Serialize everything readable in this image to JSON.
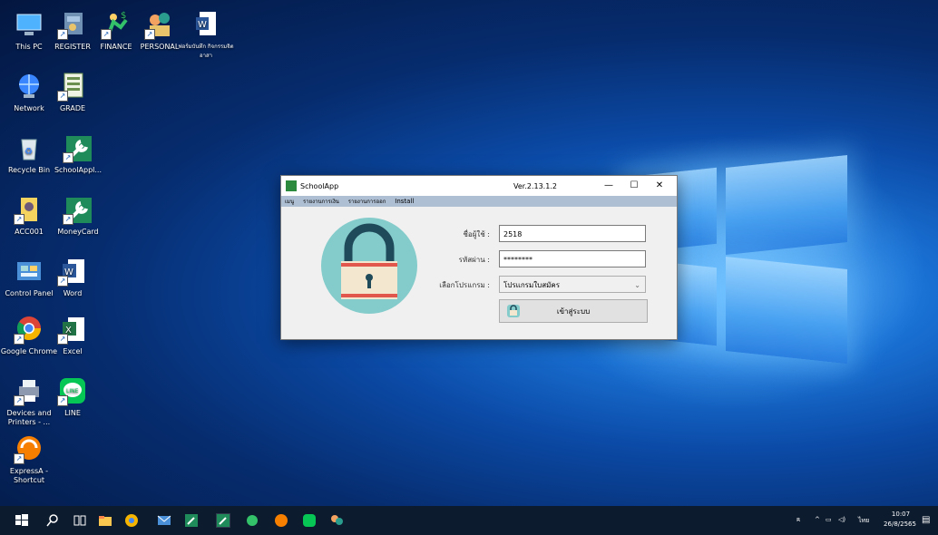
{
  "desktop": {
    "icons": [
      {
        "label": "This PC"
      },
      {
        "label": "REGISTER"
      },
      {
        "label": "FINANCE"
      },
      {
        "label": "PERSONAL"
      },
      {
        "label": "ฟอร์มบันทึก กิจกรรมจิตอาสา"
      },
      {
        "label": "Network"
      },
      {
        "label": "GRADE"
      },
      {
        "label": "Recycle Bin"
      },
      {
        "label": "SchoolAppl..."
      },
      {
        "label": "ACC001"
      },
      {
        "label": "MoneyCard"
      },
      {
        "label": "Control Panel"
      },
      {
        "label": "Word"
      },
      {
        "label": "Google Chrome"
      },
      {
        "label": "Excel"
      },
      {
        "label": "Devices and Printers - ..."
      },
      {
        "label": "LINE"
      },
      {
        "label": "ExpressA - Shortcut"
      }
    ]
  },
  "window": {
    "title": "SchoolApp",
    "version": "Ver.2.13.1.2",
    "minimize": "—",
    "maximize": "☐",
    "close": "✕",
    "menu": [
      "เมนู",
      "รายงานการเงิน",
      "รายงานการออก",
      "Install"
    ],
    "form": {
      "username_label": "ชื่อผู้ใช้ :",
      "username_value": "2518",
      "password_label": "รหัสผ่าน :",
      "password_value": "********",
      "program_label": "เลือกโปรแกรม :",
      "program_value": "โปรแกรมใบสมัคร",
      "login_button": "เข้าสู่ระบบ"
    }
  },
  "taskbar": {
    "tray_lang": "ไทย",
    "time": "10:07",
    "date": "26/8/2565"
  },
  "colors": {
    "accent": "#1a73d6",
    "lock_bg": "#84cbcb",
    "lock_body": "#f3e7cf",
    "lock_stripe": "#e2574c",
    "lock_shackle": "#1f4a5a"
  }
}
